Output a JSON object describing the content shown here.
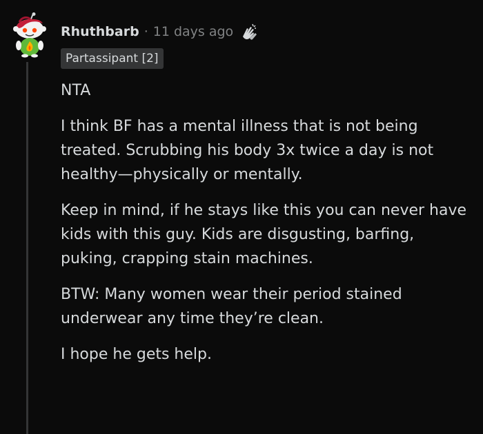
{
  "comment": {
    "username": "Rhuthbarb",
    "separator": "·",
    "timestamp": "11 days ago",
    "flair": "Partassipant [2]",
    "avatar_icon": "snoo-avatar-icon",
    "award_icon": "hands-award-icon",
    "paragraphs": [
      "NTA",
      "I think BF has a mental illness that is not being treated. Scrubbing his body 3x twice a day is not healthy—physically or mentally.",
      "Keep in mind, if he stays like this you can never have kids with this guy. Kids are disgusting, barfing, puking, crapping stain machines.",
      "BTW: Many women wear their period stained underwear any time they’re clean.",
      "I hope he gets help."
    ]
  },
  "colors": {
    "background": "#0b0b0b",
    "text": "#d7dadc",
    "meta": "#818384",
    "flair_bg": "#343536",
    "thread_line": "#343536"
  }
}
